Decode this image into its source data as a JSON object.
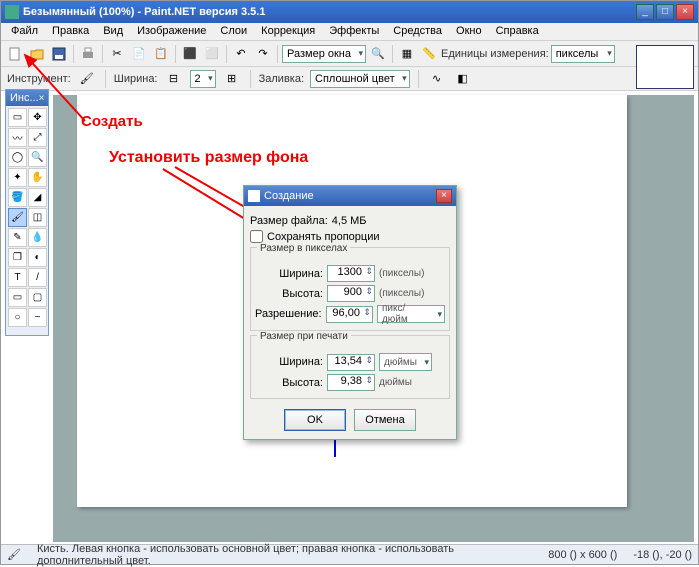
{
  "titlebar": {
    "text": "Безымянный (100%) - Paint.NET версия 3.5.1"
  },
  "menu": {
    "file": "Файл",
    "edit": "Правка",
    "view": "Вид",
    "image": "Изображение",
    "layers": "Слои",
    "adjust": "Коррекция",
    "effects": "Эффекты",
    "tools": "Средства",
    "window": "Окно",
    "help": "Справка"
  },
  "toolbar": {
    "size_combo": "Размер окна",
    "units_label": "Единицы измерения:",
    "units_value": "пикселы"
  },
  "toolbar2": {
    "tool_label": "Инструмент:",
    "width_label": "Ширина:",
    "width_value": "2",
    "fill_label": "Заливка:",
    "fill_value": "Сплошной цвет"
  },
  "toolbox": {
    "title": "Инс..."
  },
  "annot": {
    "create": "Создать",
    "setsize": "Установить размер фона"
  },
  "dialog": {
    "title": "Создание",
    "filesize_label": "Размер файла:",
    "filesize_value": "4,5 МБ",
    "keep_aspect": "Сохранять пропорции",
    "group_pixels": "Размер в пикселах",
    "width_label": "Ширина:",
    "width_value": "1300",
    "width_unit": "(пикселы)",
    "height_label": "Высота:",
    "height_value": "900",
    "height_unit": "(пикселы)",
    "res_label": "Разрешение:",
    "res_value": "96,00",
    "res_unit": "пикс/дюйм",
    "group_print": "Размер при печати",
    "pwidth_label": "Ширина:",
    "pwidth_value": "13,54",
    "pwidth_unit": "дюймы",
    "pheight_label": "Высота:",
    "pheight_value": "9,38",
    "pheight_unit": "дюймы",
    "ok": "OK",
    "cancel": "Отмена"
  },
  "status": {
    "hint": "Кисть. Левая кнопка - использовать основной цвет; правая кнопка - использовать дополнительный цвет.",
    "dims": "800 () x 600 ()",
    "coords": "-18 (), -20 ()"
  }
}
